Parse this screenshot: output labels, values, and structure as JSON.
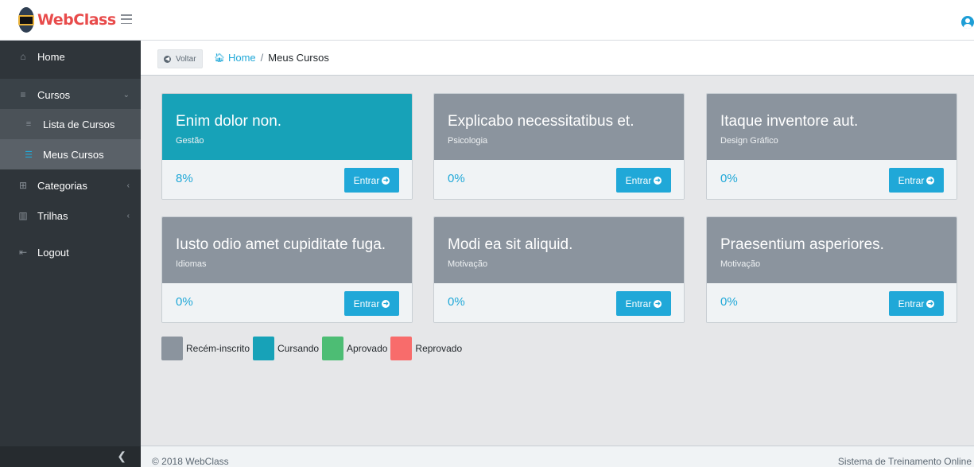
{
  "app": {
    "brand": "WebClass"
  },
  "sidebar": {
    "items": [
      {
        "label": "Home",
        "icon": "home-icon"
      },
      {
        "label": "Cursos",
        "icon": "list-icon"
      },
      {
        "label": "Lista de Cursos",
        "icon": "list-icon"
      },
      {
        "label": "Meus Cursos",
        "icon": "menu-icon"
      },
      {
        "label": "Categorias",
        "icon": "grid-icon"
      },
      {
        "label": "Trilhas",
        "icon": "columns-icon"
      },
      {
        "label": "Logout",
        "icon": "logout-icon"
      }
    ]
  },
  "breadcrumb": {
    "back": "Voltar",
    "home": "Home",
    "current": "Meus Cursos"
  },
  "cards": [
    {
      "title": "Enim dolor non.",
      "category": "Gestão",
      "progress": "8%",
      "button": "Entrar",
      "status": "Cursando"
    },
    {
      "title": "Explicabo necessitatibus et.",
      "category": "Psicologia",
      "progress": "0%",
      "button": "Entrar",
      "status": "Recém-inscrito"
    },
    {
      "title": "Itaque inventore aut.",
      "category": "Design Gráfico",
      "progress": "0%",
      "button": "Entrar",
      "status": "Recém-inscrito"
    },
    {
      "title": "Iusto odio amet cupiditate fuga.",
      "category": "Idiomas",
      "progress": "0%",
      "button": "Entrar",
      "status": "Recém-inscrito"
    },
    {
      "title": "Modi ea sit aliquid.",
      "category": "Motivação",
      "progress": "0%",
      "button": "Entrar",
      "status": "Recém-inscrito"
    },
    {
      "title": "Praesentium asperiores.",
      "category": "Motivação",
      "progress": "0%",
      "button": "Entrar",
      "status": "Recém-inscrito"
    }
  ],
  "legend": [
    {
      "label": "Recém-inscrito",
      "color": "#8b949e"
    },
    {
      "label": "Cursando",
      "color": "#17a2b8"
    },
    {
      "label": "Aprovado",
      "color": "#4dbd74"
    },
    {
      "label": "Reprovado",
      "color": "#f86c6b"
    }
  ],
  "footer": {
    "copyright": "© 2018 WebClass",
    "system": "Sistema de Treinamento Online"
  }
}
